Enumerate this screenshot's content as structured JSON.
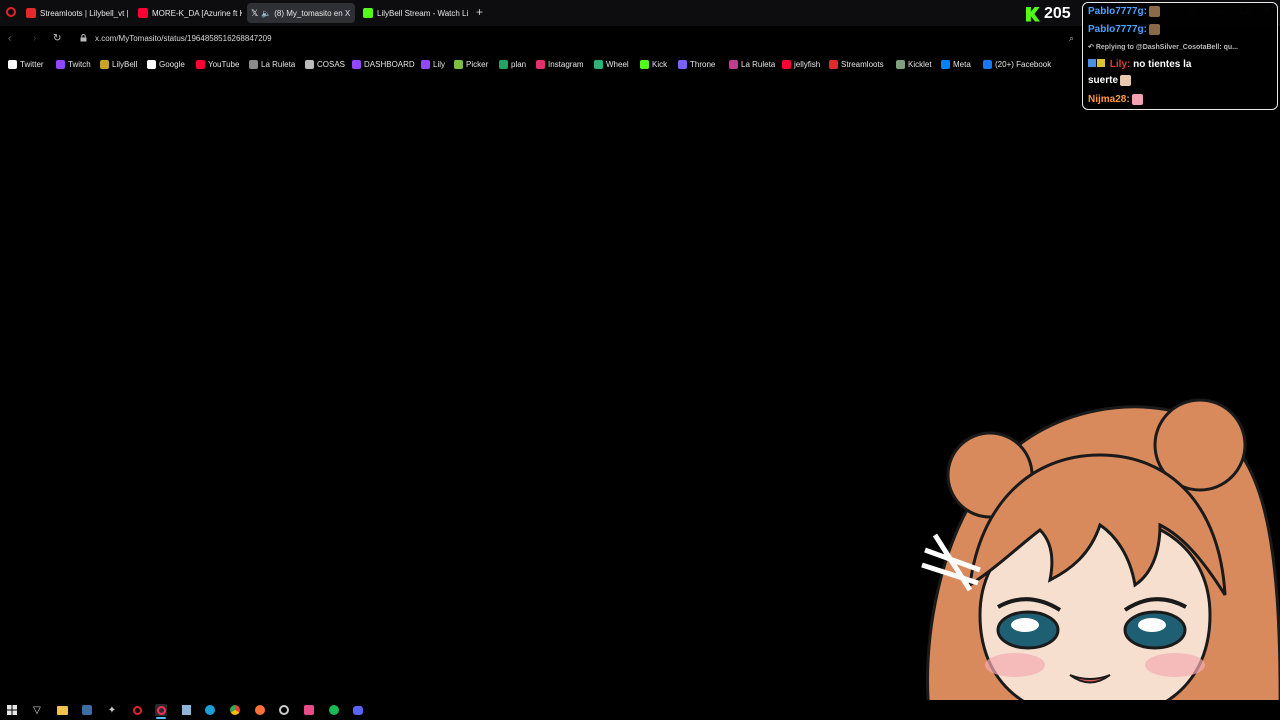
{
  "browser": {
    "tabs": [
      {
        "label": "Streamloots | Lilybell_vt |",
        "icon": "streamloots-icon",
        "color": "#e52929"
      },
      {
        "label": "MORE-K_DA [Azurine ft K",
        "icon": "youtube-icon",
        "color": "#ff0033"
      },
      {
        "label": "(8) My_tomasito en X",
        "icon": "x-icon",
        "color": "#ffffff"
      },
      {
        "label": "LilyBell Stream - Watch Li",
        "icon": "kick-icon",
        "color": "#53fc18"
      }
    ],
    "new_tab": "+",
    "url": "x.com/MyTomasito/status/1964858516268847209",
    "bookmarks": [
      {
        "label": "Twitter",
        "icon": "x-icon",
        "color": "#ffffff"
      },
      {
        "label": "Twitch",
        "icon": "twitch-icon",
        "color": "#9146ff"
      },
      {
        "label": "LilyBell",
        "icon": "crown-icon",
        "color": "#c9a227"
      },
      {
        "label": "Google",
        "icon": "google-icon",
        "color": "#ffffff"
      },
      {
        "label": "YouTube",
        "icon": "youtube-icon",
        "color": "#ff0033"
      },
      {
        "label": "La Ruleta",
        "icon": "globe-icon",
        "color": "#8a8a8a"
      },
      {
        "label": "COSAS",
        "icon": "folder-icon",
        "color": "#bbbbbb"
      },
      {
        "label": "DASHBOARD",
        "icon": "twitch-icon",
        "color": "#9146ff"
      },
      {
        "label": "Lily",
        "icon": "twitch-icon",
        "color": "#9146ff"
      },
      {
        "label": "Picker",
        "icon": "picker-icon",
        "color": "#7fbf3f"
      },
      {
        "label": "plan",
        "icon": "sheets-icon",
        "color": "#1fa463"
      },
      {
        "label": "Instagram",
        "icon": "instagram-icon",
        "color": "#e1306c"
      },
      {
        "label": "Wheel",
        "icon": "wheel-icon",
        "color": "#2ab37a"
      },
      {
        "label": "Kick",
        "icon": "kick-icon",
        "color": "#53fc18"
      },
      {
        "label": "Throne",
        "icon": "throne-icon",
        "color": "#7b61ff"
      },
      {
        "label": "La Ruleta",
        "icon": "dot-icon",
        "color": "#c03c8e"
      },
      {
        "label": "jellyfish",
        "icon": "youtube-icon",
        "color": "#ff0033"
      },
      {
        "label": "Streamloots",
        "icon": "streamloots-icon",
        "color": "#e52929"
      },
      {
        "label": "Kicklet",
        "icon": "kicklet-icon",
        "color": "#7fa07f"
      },
      {
        "label": "Meta",
        "icon": "meta-icon",
        "color": "#0082fb"
      },
      {
        "label": "(20+) Facebook",
        "icon": "facebook-icon",
        "color": "#1877f2"
      }
    ]
  },
  "overlay": {
    "kick_count": "205",
    "chat": {
      "lines": [
        {
          "user": "Pablo7777g:",
          "user_color": "#4aa3ff"
        },
        {
          "user": "Pablo7777g:",
          "user_color": "#4aa3ff"
        },
        {
          "reply": "Replying to @DashSilver_CosotaBell: qu..."
        },
        {
          "user": "Lily:",
          "user_color": "#e23b3b",
          "text": "no tientes la"
        },
        {
          "text": "suerte"
        },
        {
          "user": "Nijma28:",
          "user_color": "#ff9a3c"
        }
      ]
    }
  }
}
